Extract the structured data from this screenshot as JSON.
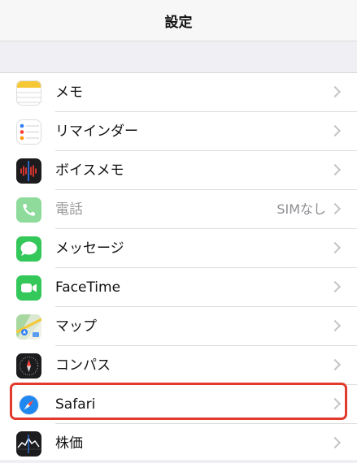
{
  "navbar": {
    "title": "設定"
  },
  "rows": [
    {
      "label": "メモ",
      "icon": "notes-icon"
    },
    {
      "label": "リマインダー",
      "icon": "reminders-icon"
    },
    {
      "label": "ボイスメモ",
      "icon": "voice-memos-icon"
    },
    {
      "label": "電話",
      "icon": "phone-icon",
      "detail": "SIMなし",
      "disabled": true
    },
    {
      "label": "メッセージ",
      "icon": "messages-icon"
    },
    {
      "label": "FaceTime",
      "icon": "facetime-icon"
    },
    {
      "label": "マップ",
      "icon": "maps-icon"
    },
    {
      "label": "コンパス",
      "icon": "compass-icon"
    },
    {
      "label": "Safari",
      "icon": "safari-icon",
      "highlighted": true
    },
    {
      "label": "株価",
      "icon": "stocks-icon"
    }
  ],
  "colors": {
    "highlight": "#e23b2e",
    "background": "#efeff4"
  }
}
